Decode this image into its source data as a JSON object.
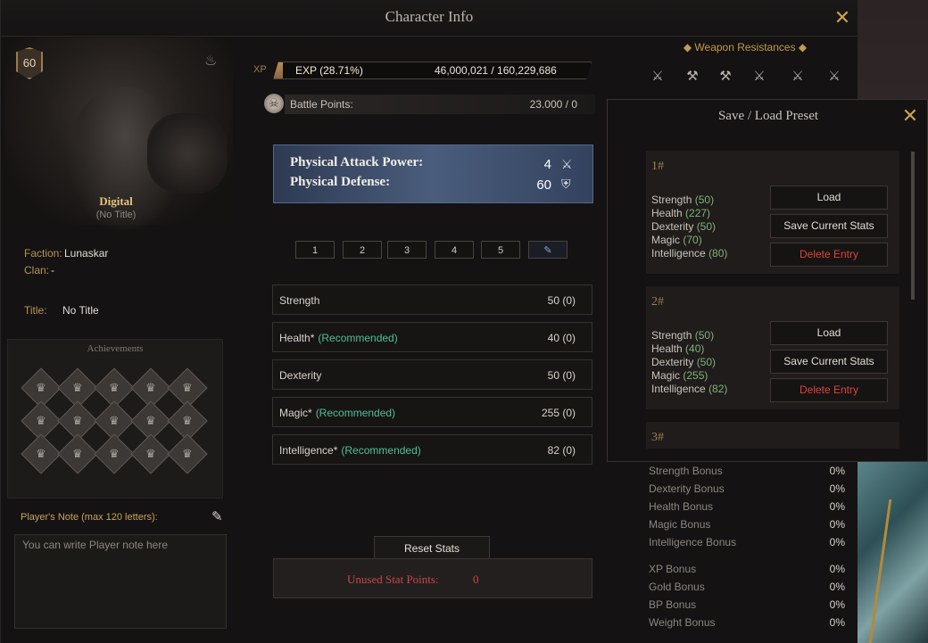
{
  "window": {
    "title": "Character Info",
    "close_icon": "close-x-icon"
  },
  "character": {
    "level": "60",
    "name": "Digital",
    "title_sub": "(No Title)",
    "faction_label": "Faction:",
    "faction": "Lunaskar",
    "clan_label": "Clan:",
    "clan": "-",
    "title_label": "Title:",
    "title_value": "No Title"
  },
  "achievements": {
    "title": "Achievements",
    "count": 15
  },
  "note": {
    "label": "Player's Note (max 120 letters):",
    "placeholder": "You can write Player note here"
  },
  "xp": {
    "label": "XP",
    "percent_text": "EXP (28.71%)",
    "percent": 28.71,
    "values_text": "46,000,021 / 160,229,686"
  },
  "battle_points": {
    "label": "Battle Points:",
    "value": "23.000 / 0"
  },
  "combat_stats": {
    "attack_label": "Physical Attack Power:",
    "attack_value": "4",
    "defense_label": "Physical Defense:",
    "defense_value": "60"
  },
  "preset_tabs": [
    "1",
    "2",
    "3",
    "4",
    "5"
  ],
  "stats": [
    {
      "name": "Strength",
      "rec": "",
      "value": "50 (0)"
    },
    {
      "name": "Health*",
      "rec": "(Recommended)",
      "value": "40 (0)"
    },
    {
      "name": "Dexterity",
      "rec": "",
      "value": "50 (0)"
    },
    {
      "name": "Magic*",
      "rec": "(Recommended)",
      "value": "255 (0)"
    },
    {
      "name": "Intelligence*",
      "rec": "(Recommended)",
      "value": "82 (0)"
    }
  ],
  "reset_label": "Reset Stats",
  "unused": {
    "label": "Unused Stat Points:",
    "value": "0"
  },
  "resistances": {
    "title": "Weapon Resistances"
  },
  "bonuses": [
    {
      "name": "Strength Bonus",
      "value": "0%"
    },
    {
      "name": "Dexterity Bonus",
      "value": "0%"
    },
    {
      "name": "Health Bonus",
      "value": "0%"
    },
    {
      "name": "Magic Bonus",
      "value": "0%"
    },
    {
      "name": "Intelligence Bonus",
      "value": "0%"
    },
    {
      "name": "XP Bonus",
      "value": "0%"
    },
    {
      "name": "Gold Bonus",
      "value": "0%"
    },
    {
      "name": "BP Bonus",
      "value": "0%"
    },
    {
      "name": "Weight Bonus",
      "value": "0%"
    }
  ],
  "preset_window": {
    "title": "Save / Load Preset",
    "load_label": "Load",
    "save_label": "Save Current Stats",
    "delete_label": "Delete Entry",
    "presets": [
      {
        "num": "1#",
        "strength": "(50)",
        "health": "(227)",
        "dexterity": "(50)",
        "magic": "(70)",
        "intelligence": "(80)"
      },
      {
        "num": "2#",
        "strength": "(50)",
        "health": "(40)",
        "dexterity": "(50)",
        "magic": "(255)",
        "intelligence": "(82)"
      },
      {
        "num": "3#"
      }
    ],
    "stat_labels": {
      "strength": "Strength",
      "health": "Health",
      "dexterity": "Dexterity",
      "magic": "Magic",
      "intelligence": "Intelligence"
    }
  }
}
